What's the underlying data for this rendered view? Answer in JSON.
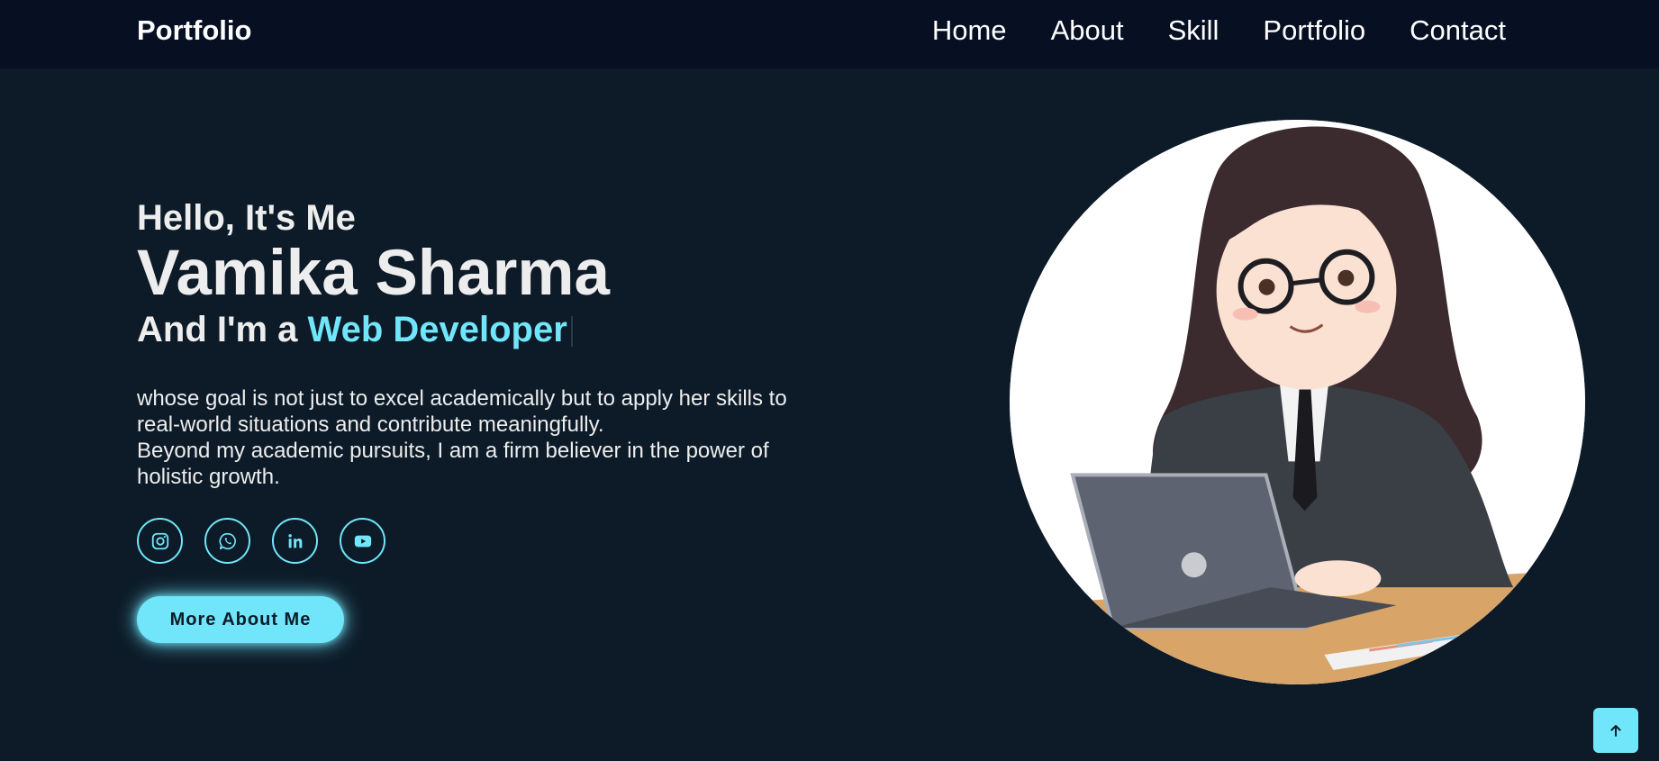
{
  "header": {
    "logo": "Portfolio",
    "nav": [
      "Home",
      "About",
      "Skill",
      "Portfolio",
      "Contact"
    ]
  },
  "hero": {
    "greeting": "Hello, It's Me",
    "name": "Vamika Sharma",
    "role_prefix": "And I'm a",
    "role_highlight": "Web Developer",
    "description_1": "whose goal is not just to excel academically but to apply her skills to real-world situations and contribute meaningfully.",
    "description_2": "Beyond my academic pursuits, I am a firm believer in the power of holistic growth.",
    "cta_label": "More About Me"
  },
  "socials": [
    "instagram-icon",
    "whatsapp-icon",
    "linkedin-icon",
    "youtube-icon"
  ],
  "colors": {
    "accent": "#71e5f9",
    "background": "#0d1b28",
    "navbar": "#070f23",
    "text": "#ededed"
  }
}
